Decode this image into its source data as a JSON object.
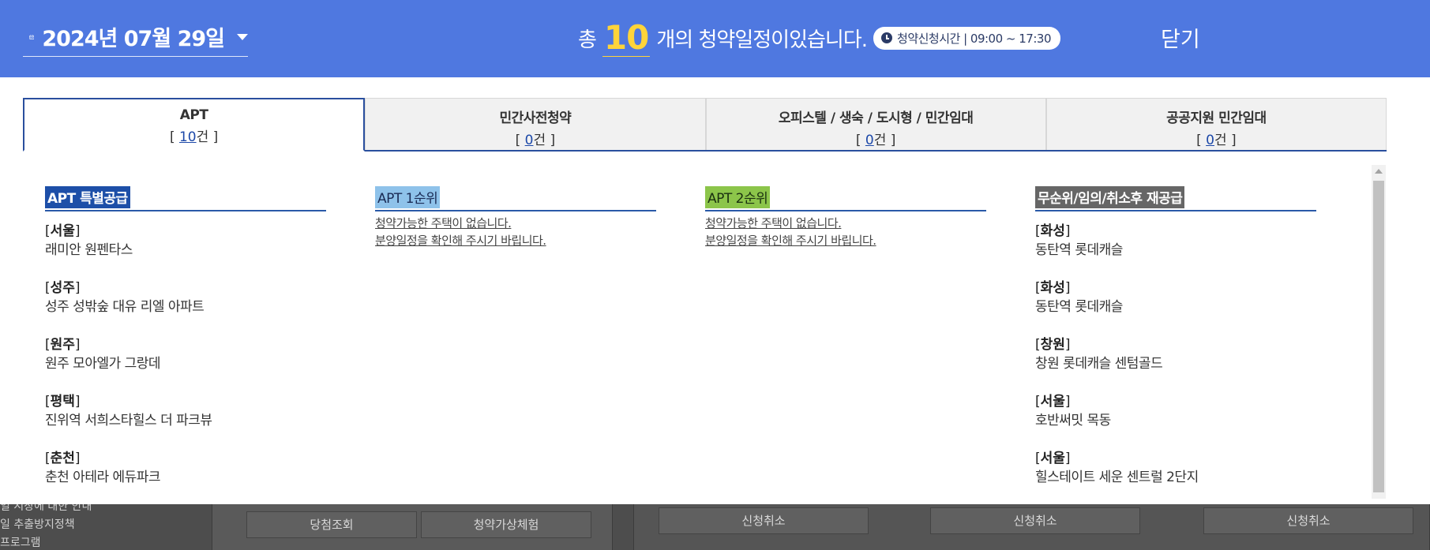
{
  "header": {
    "date": "2024년 07월 29일",
    "summary_prefix": "총",
    "summary_count": "10",
    "summary_suffix": "개의 청약일정이있습니다.",
    "time_badge": "청약신청시간 | 09:00 ~ 17:30",
    "close_label": "닫기",
    "background_color": "#4f78e0",
    "count_color": "#ffd43a"
  },
  "tabs": [
    {
      "label": "APT",
      "count": "10",
      "unit": "건",
      "active": true
    },
    {
      "label": "민간사전청약",
      "count": "0",
      "unit": "건",
      "active": false
    },
    {
      "label": "오피스텔 / 생숙 / 도시형 / 민간임대",
      "count": "0",
      "unit": "건",
      "active": false
    },
    {
      "label": "공공지원 민간임대",
      "count": "0",
      "unit": "건",
      "active": false
    }
  ],
  "columns": {
    "special": {
      "title": "APT 특별공급",
      "items": [
        {
          "region": "서울",
          "name": "래미안 원펜타스"
        },
        {
          "region": "성주",
          "name": "성주 성밖숲 대유 리엘 아파트"
        },
        {
          "region": "원주",
          "name": "원주 모아엘가 그랑데"
        },
        {
          "region": "평택",
          "name": "진위역 서희스타힐스 더 파크뷰"
        },
        {
          "region": "춘천",
          "name": "춘천 아테라 에듀파크"
        }
      ]
    },
    "first": {
      "title": "APT 1순위",
      "empty_line1": "청약가능한 주택이 없습니다.",
      "empty_line2": "분양일정을 확인해 주시기 바립니다."
    },
    "second": {
      "title": "APT 2순위",
      "empty_line1": "청약가능한 주택이 없습니다.",
      "empty_line2": "분양일정을 확인해 주시기 바립니다."
    },
    "reissue": {
      "title": "무순위/임의/취소후 재공급",
      "items": [
        {
          "region": "화성",
          "name": "동탄역 롯데캐슬"
        },
        {
          "region": "화성",
          "name": "동탄역 롯데캐슬"
        },
        {
          "region": "창원",
          "name": "창원 롯데캐슬 센텀골드"
        },
        {
          "region": "서울",
          "name": "호반써밋 목동"
        },
        {
          "region": "서울",
          "name": "힐스테이트 세운 센트럴 2단지"
        }
      ]
    }
  },
  "background_page": {
    "side_list": [
      "일 시장에 대한 안내",
      "일 추출방지정책",
      "프로그램"
    ],
    "buttons": [
      "당첨조회",
      "청약가상체험",
      "신청취소",
      "신청취소",
      "신청취소"
    ]
  }
}
